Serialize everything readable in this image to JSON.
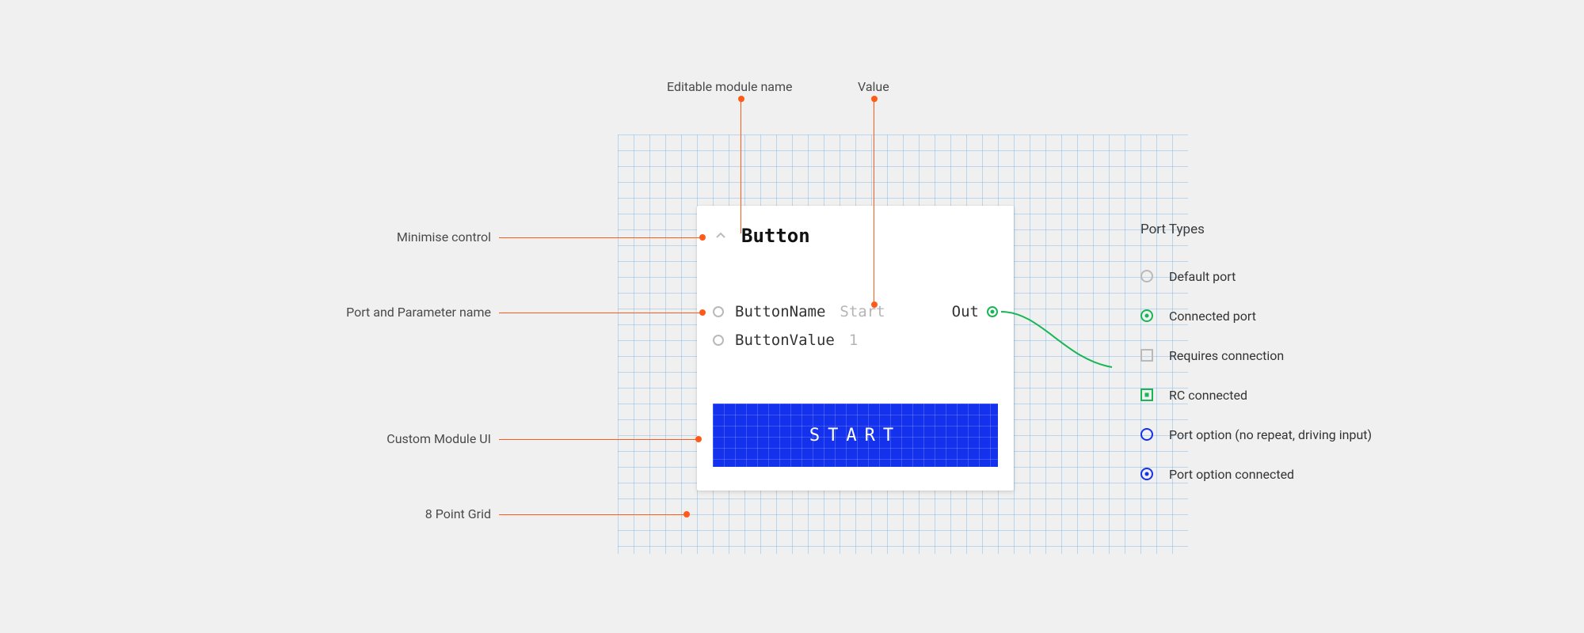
{
  "callouts": {
    "editable_module_name": "Editable module name",
    "value": "Value",
    "minimise_control": "Minimise control",
    "port_and_parameter_name": "Port and Parameter name",
    "custom_module_ui": "Custom Module UI",
    "eight_point_grid": "8 Point Grid"
  },
  "module": {
    "title": "Button",
    "params": [
      {
        "name": "ButtonName",
        "value": "Start"
      },
      {
        "name": "ButtonValue",
        "value": "1"
      }
    ],
    "output_label": "Out",
    "start_button": "START"
  },
  "legend": {
    "title": "Port Types",
    "items": {
      "default_port": "Default port",
      "connected_port": "Connected port",
      "requires_connection": "Requires connection",
      "rc_connected": "RC connected",
      "port_option": "Port option (no repeat, driving input)",
      "port_option_connected": "Port option connected"
    }
  },
  "colors": {
    "accent_orange": "#ff5a17",
    "accent_blue": "#1431ee",
    "accent_green": "#18b656"
  }
}
